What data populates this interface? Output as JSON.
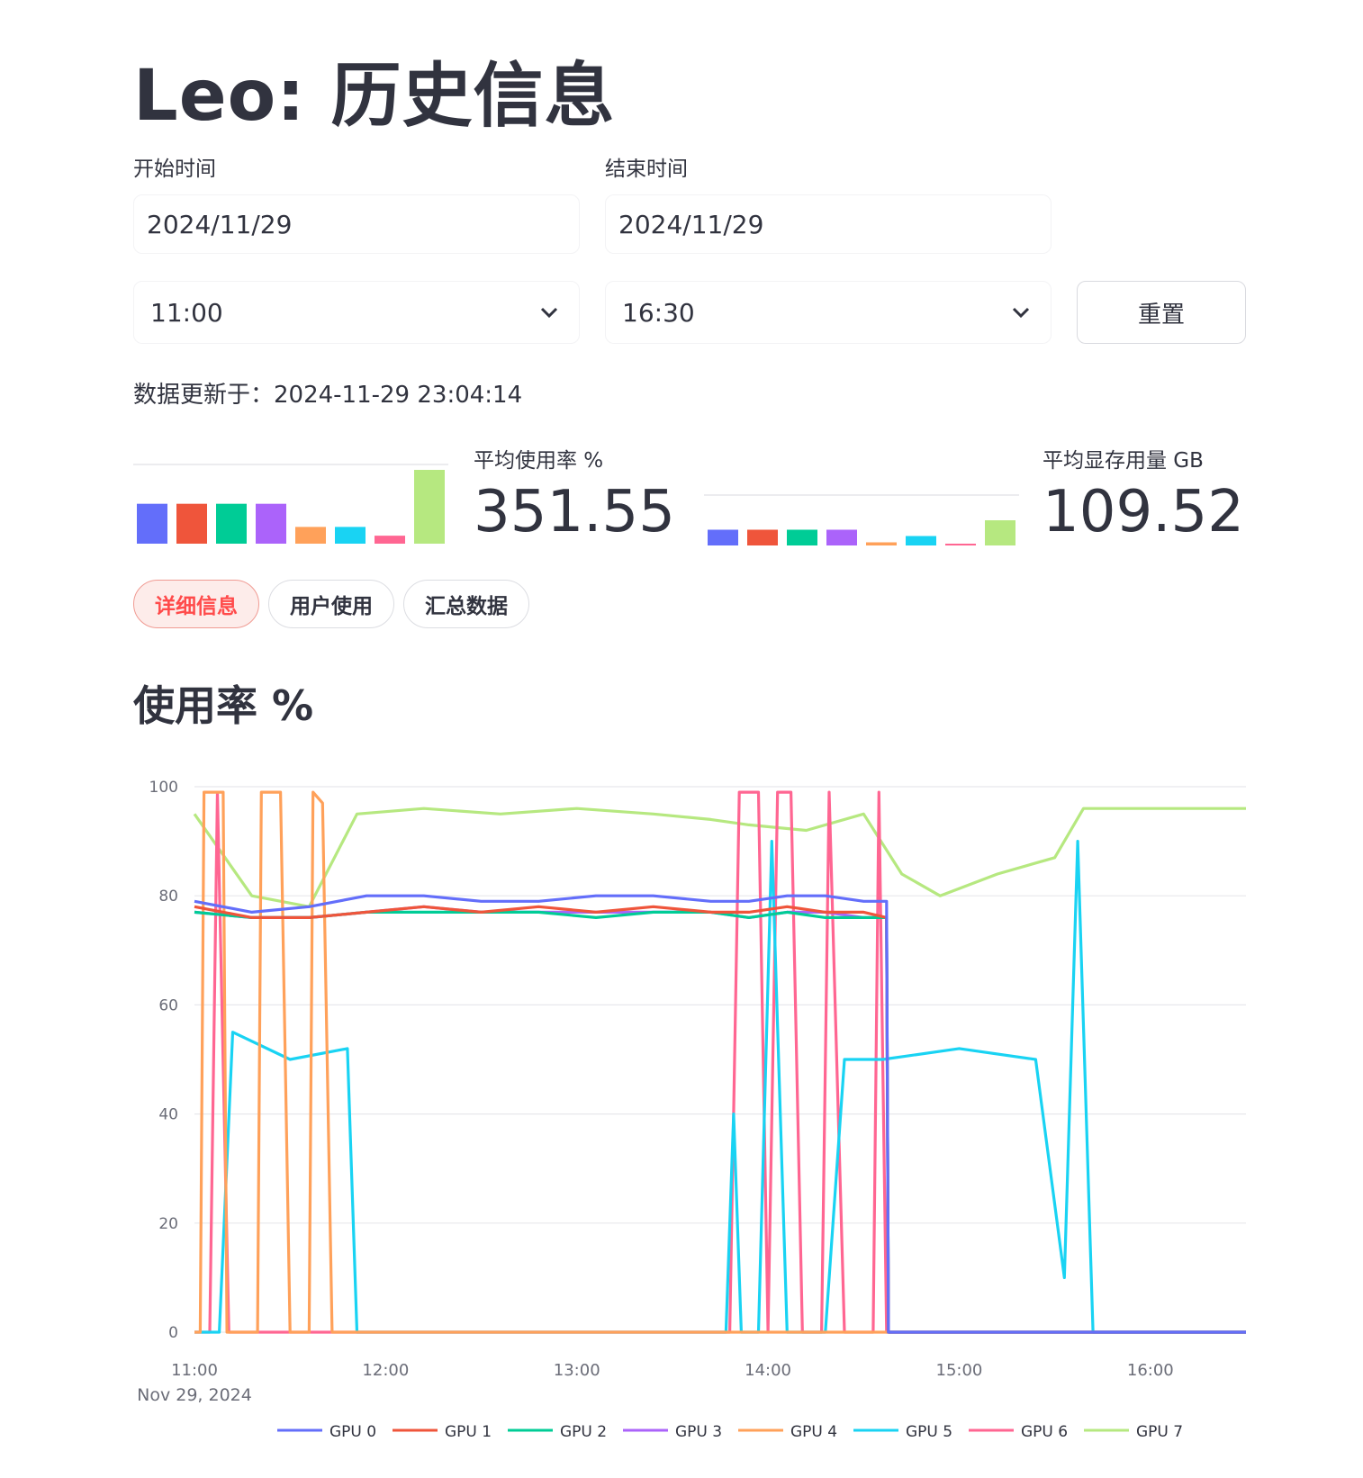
{
  "header": {
    "title": "Leo: 历史信息"
  },
  "filters": {
    "start_label": "开始时间",
    "end_label": "结束时间",
    "start_date": "2024/11/29",
    "end_date": "2024/11/29",
    "start_time": "11:00",
    "end_time": "16:30",
    "reset_label": "重置"
  },
  "updated": {
    "text": "数据更新于：2024-11-29 23:04:14"
  },
  "metrics": {
    "usage": {
      "label": "平均使用率 %",
      "value": "351.55",
      "bars": [
        100,
        100,
        100,
        100,
        42,
        42,
        20,
        185
      ],
      "colors": [
        "#636efa",
        "#ef553b",
        "#00cc96",
        "#ab63fa",
        "#ffa15a",
        "#19d3f3",
        "#ff6692",
        "#b6e880"
      ]
    },
    "memory": {
      "label": "平均显存用量 GB",
      "value": "109.52",
      "bars": [
        100,
        100,
        100,
        100,
        20,
        60,
        5,
        160
      ],
      "colors": [
        "#636efa",
        "#ef553b",
        "#00cc96",
        "#ab63fa",
        "#ffa15a",
        "#19d3f3",
        "#ff6692",
        "#b6e880"
      ]
    }
  },
  "tabs": [
    {
      "label": "详细信息",
      "active": true
    },
    {
      "label": "用户使用",
      "active": false
    },
    {
      "label": "汇总数据",
      "active": false
    }
  ],
  "section": {
    "title": "使用率 %"
  },
  "chart_data": {
    "type": "line",
    "title": "",
    "xlabel": "",
    "ylabel": "",
    "ylim": [
      0,
      100
    ],
    "yticks": [
      "0",
      "20",
      "40",
      "60",
      "80",
      "100"
    ],
    "xticks": [
      "11:00",
      "12:00",
      "13:00",
      "14:00",
      "15:00",
      "16:00"
    ],
    "x_date_label": "Nov 29, 2024",
    "x_range_hours": [
      11.0,
      16.5
    ],
    "grid": true,
    "legend_position": "bottom",
    "series": [
      {
        "name": "GPU 0",
        "color": "#636efa",
        "points": [
          [
            11.0,
            79
          ],
          [
            11.3,
            77
          ],
          [
            11.6,
            78
          ],
          [
            11.9,
            80
          ],
          [
            12.2,
            80
          ],
          [
            12.5,
            79
          ],
          [
            12.8,
            79
          ],
          [
            13.1,
            80
          ],
          [
            13.4,
            80
          ],
          [
            13.7,
            79
          ],
          [
            13.9,
            79
          ],
          [
            14.1,
            80
          ],
          [
            14.3,
            80
          ],
          [
            14.5,
            79
          ],
          [
            14.62,
            79
          ],
          [
            14.63,
            0
          ],
          [
            16.5,
            0
          ]
        ]
      },
      {
        "name": "GPU 1",
        "color": "#ef553b",
        "points": [
          [
            11.0,
            78
          ],
          [
            11.3,
            76
          ],
          [
            11.6,
            76
          ],
          [
            11.9,
            77
          ],
          [
            12.2,
            78
          ],
          [
            12.5,
            77
          ],
          [
            12.8,
            78
          ],
          [
            13.1,
            77
          ],
          [
            13.4,
            78
          ],
          [
            13.7,
            77
          ],
          [
            13.9,
            77
          ],
          [
            14.1,
            78
          ],
          [
            14.3,
            77
          ],
          [
            14.5,
            77
          ],
          [
            14.62,
            76
          ],
          [
            14.63,
            0
          ],
          [
            16.5,
            0
          ]
        ]
      },
      {
        "name": "GPU 2",
        "color": "#00cc96",
        "points": [
          [
            11.0,
            77
          ],
          [
            11.3,
            76
          ],
          [
            11.6,
            76
          ],
          [
            11.9,
            77
          ],
          [
            12.2,
            77
          ],
          [
            12.5,
            77
          ],
          [
            12.8,
            77
          ],
          [
            13.1,
            76
          ],
          [
            13.4,
            77
          ],
          [
            13.7,
            77
          ],
          [
            13.9,
            76
          ],
          [
            14.1,
            77
          ],
          [
            14.3,
            76
          ],
          [
            14.5,
            76
          ],
          [
            14.62,
            76
          ],
          [
            14.63,
            0
          ],
          [
            16.5,
            0
          ]
        ]
      },
      {
        "name": "GPU 3",
        "color": "#ab63fa",
        "points": [
          [
            11.0,
            77
          ],
          [
            11.3,
            76
          ],
          [
            11.6,
            76
          ],
          [
            11.9,
            77
          ],
          [
            12.2,
            78
          ],
          [
            12.5,
            77
          ],
          [
            12.8,
            77
          ],
          [
            13.1,
            77
          ],
          [
            13.4,
            77
          ],
          [
            13.7,
            77
          ],
          [
            13.9,
            76
          ],
          [
            14.1,
            77
          ],
          [
            14.3,
            77
          ],
          [
            14.5,
            76
          ],
          [
            14.62,
            76
          ],
          [
            14.63,
            0
          ],
          [
            16.5,
            0
          ]
        ]
      },
      {
        "name": "GPU 4",
        "color": "#ffa15a",
        "points": [
          [
            11.0,
            0
          ],
          [
            11.03,
            0
          ],
          [
            11.05,
            99
          ],
          [
            11.15,
            99
          ],
          [
            11.17,
            0
          ],
          [
            11.33,
            0
          ],
          [
            11.35,
            99
          ],
          [
            11.45,
            99
          ],
          [
            11.5,
            0
          ],
          [
            11.6,
            0
          ],
          [
            11.62,
            99
          ],
          [
            11.67,
            97
          ],
          [
            11.72,
            0
          ],
          [
            11.84,
            0
          ],
          [
            16.5,
            0
          ]
        ]
      },
      {
        "name": "GPU 5",
        "color": "#19d3f3",
        "points": [
          [
            11.0,
            0
          ],
          [
            11.13,
            0
          ],
          [
            11.2,
            55
          ],
          [
            11.5,
            50
          ],
          [
            11.8,
            52
          ],
          [
            11.85,
            0
          ],
          [
            13.78,
            0
          ],
          [
            13.82,
            40
          ],
          [
            13.86,
            0
          ],
          [
            13.95,
            0
          ],
          [
            14.02,
            90
          ],
          [
            14.1,
            0
          ],
          [
            14.3,
            0
          ],
          [
            14.4,
            50
          ],
          [
            14.6,
            50
          ],
          [
            15.0,
            52
          ],
          [
            15.4,
            50
          ],
          [
            15.55,
            10
          ],
          [
            15.62,
            90
          ],
          [
            15.7,
            0
          ],
          [
            16.5,
            0
          ]
        ]
      },
      {
        "name": "GPU 6",
        "color": "#ff6692",
        "points": [
          [
            11.0,
            0
          ],
          [
            11.08,
            0
          ],
          [
            11.12,
            99
          ],
          [
            11.18,
            0
          ],
          [
            13.8,
            0
          ],
          [
            13.85,
            99
          ],
          [
            13.95,
            99
          ],
          [
            14.0,
            0
          ],
          [
            14.05,
            99
          ],
          [
            14.12,
            99
          ],
          [
            14.18,
            0
          ],
          [
            14.28,
            0
          ],
          [
            14.32,
            99
          ],
          [
            14.4,
            0
          ],
          [
            14.55,
            0
          ],
          [
            14.58,
            99
          ],
          [
            14.62,
            0
          ],
          [
            16.5,
            0
          ]
        ]
      },
      {
        "name": "GPU 7",
        "color": "#b6e880",
        "points": [
          [
            11.0,
            95
          ],
          [
            11.3,
            80
          ],
          [
            11.6,
            78
          ],
          [
            11.85,
            95
          ],
          [
            12.2,
            96
          ],
          [
            12.6,
            95
          ],
          [
            13.0,
            96
          ],
          [
            13.4,
            95
          ],
          [
            13.7,
            94
          ],
          [
            13.9,
            93
          ],
          [
            14.2,
            92
          ],
          [
            14.5,
            95
          ],
          [
            14.7,
            84
          ],
          [
            14.9,
            80
          ],
          [
            15.2,
            84
          ],
          [
            15.5,
            87
          ],
          [
            15.65,
            96
          ],
          [
            16.0,
            96
          ],
          [
            16.5,
            96
          ]
        ]
      }
    ]
  }
}
